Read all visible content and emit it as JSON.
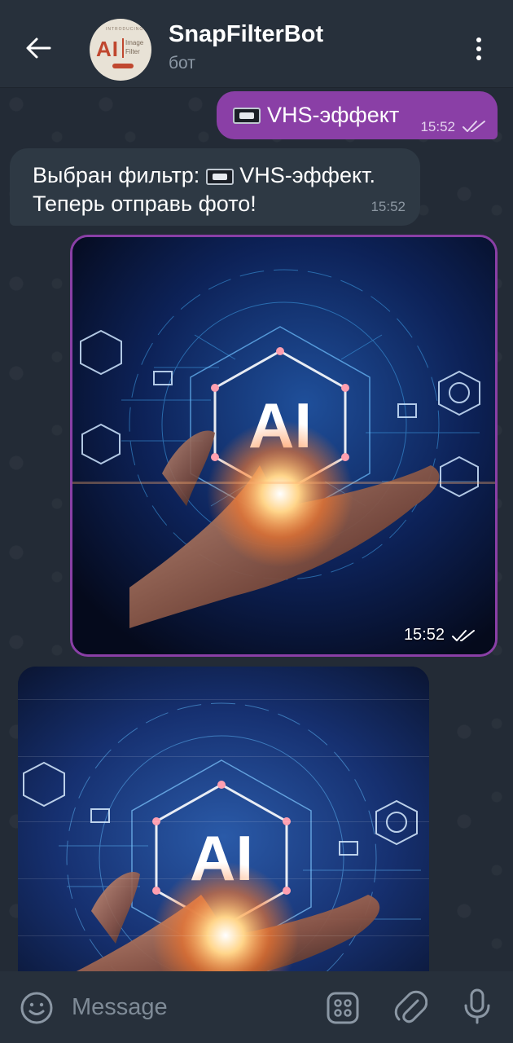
{
  "header": {
    "title": "SnapFilterBot",
    "subtitle": "бот",
    "avatar": {
      "top_text": "INTRODUCING",
      "big_text": "AI",
      "sub_text_1": "Image",
      "sub_text_2": "Filter"
    }
  },
  "messages": {
    "outgoing": {
      "icon": "videocassette-icon",
      "text": "VHS-эффект",
      "time": "15:52"
    },
    "incoming": {
      "line1_prefix": "Выбран фильтр:",
      "line1_suffix": "VHS-эффект.",
      "line2": "Теперь отправь фото!",
      "time": "15:52"
    },
    "photo_outgoing": {
      "time": "15:52",
      "image_text": "AI"
    },
    "photo_incoming": {
      "image_text": "AI"
    }
  },
  "input": {
    "placeholder": "Message"
  },
  "colors": {
    "header_bg": "#27303b",
    "chat_bg": "#232b36",
    "outgoing_bubble": "#8a3fa6",
    "incoming_bubble": "#2e3944",
    "secondary_text": "#8b97a4"
  }
}
